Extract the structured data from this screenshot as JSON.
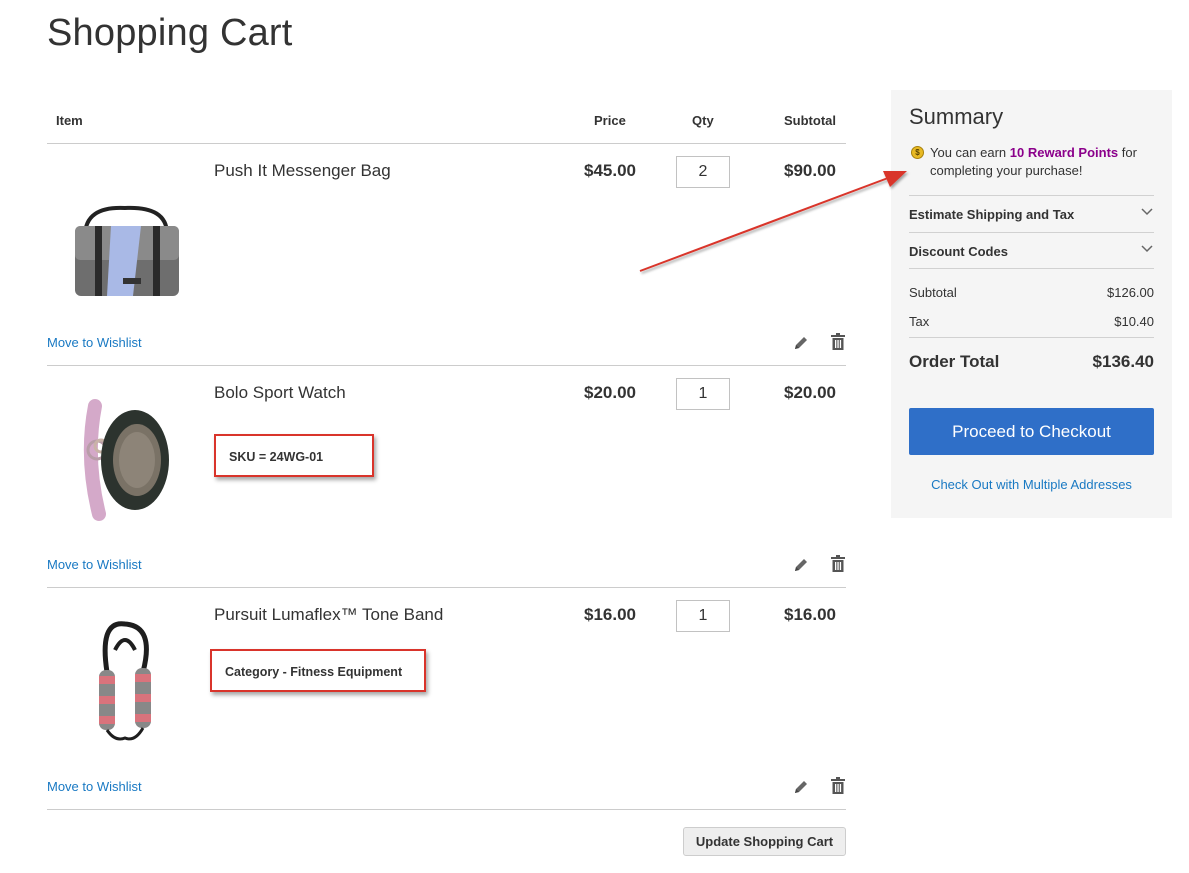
{
  "page": {
    "title": "Shopping Cart"
  },
  "cart": {
    "headers": {
      "item": "Item",
      "price": "Price",
      "qty": "Qty",
      "subtotal": "Subtotal"
    },
    "items": [
      {
        "name": "Push It Messenger Bag",
        "price": "$45.00",
        "qty": "2",
        "subtotal": "$90.00",
        "wishlist": "Move to Wishlist",
        "thumb": "messenger-bag"
      },
      {
        "name": "Bolo Sport Watch",
        "price": "$20.00",
        "qty": "1",
        "subtotal": "$20.00",
        "wishlist": "Move to Wishlist",
        "thumb": "sport-watch",
        "callout": "SKU = 24WG-01"
      },
      {
        "name": "Pursuit Lumaflex™ Tone Band",
        "price": "$16.00",
        "qty": "1",
        "subtotal": "$16.00",
        "wishlist": "Move to Wishlist",
        "thumb": "tone-band",
        "callout": "Category - Fitness Equipment"
      }
    ],
    "update_button": "Update Shopping Cart"
  },
  "summary": {
    "title": "Summary",
    "reward": {
      "prefix": "You can earn",
      "points": "10 Reward Points",
      "suffix": "for completing your purchase!"
    },
    "sections": {
      "shipping": "Estimate Shipping and Tax",
      "discount": "Discount Codes"
    },
    "totals": {
      "subtotal_label": "Subtotal",
      "subtotal": "$126.00",
      "tax_label": "Tax",
      "tax": "$10.40",
      "order_total_label": "Order Total",
      "order_total": "$136.40"
    },
    "checkout_button": "Proceed to Checkout",
    "multi_address_link": "Check Out with Multiple Addresses"
  },
  "colors": {
    "link": "#1979c3",
    "checkout": "#2f6fc8",
    "reward_points": "#8b008b",
    "callout_border": "#d9342b"
  },
  "icons": {
    "edit": "pencil-icon",
    "delete": "trash-icon",
    "coin": "coin-icon",
    "expand": "chevron-down-icon"
  }
}
